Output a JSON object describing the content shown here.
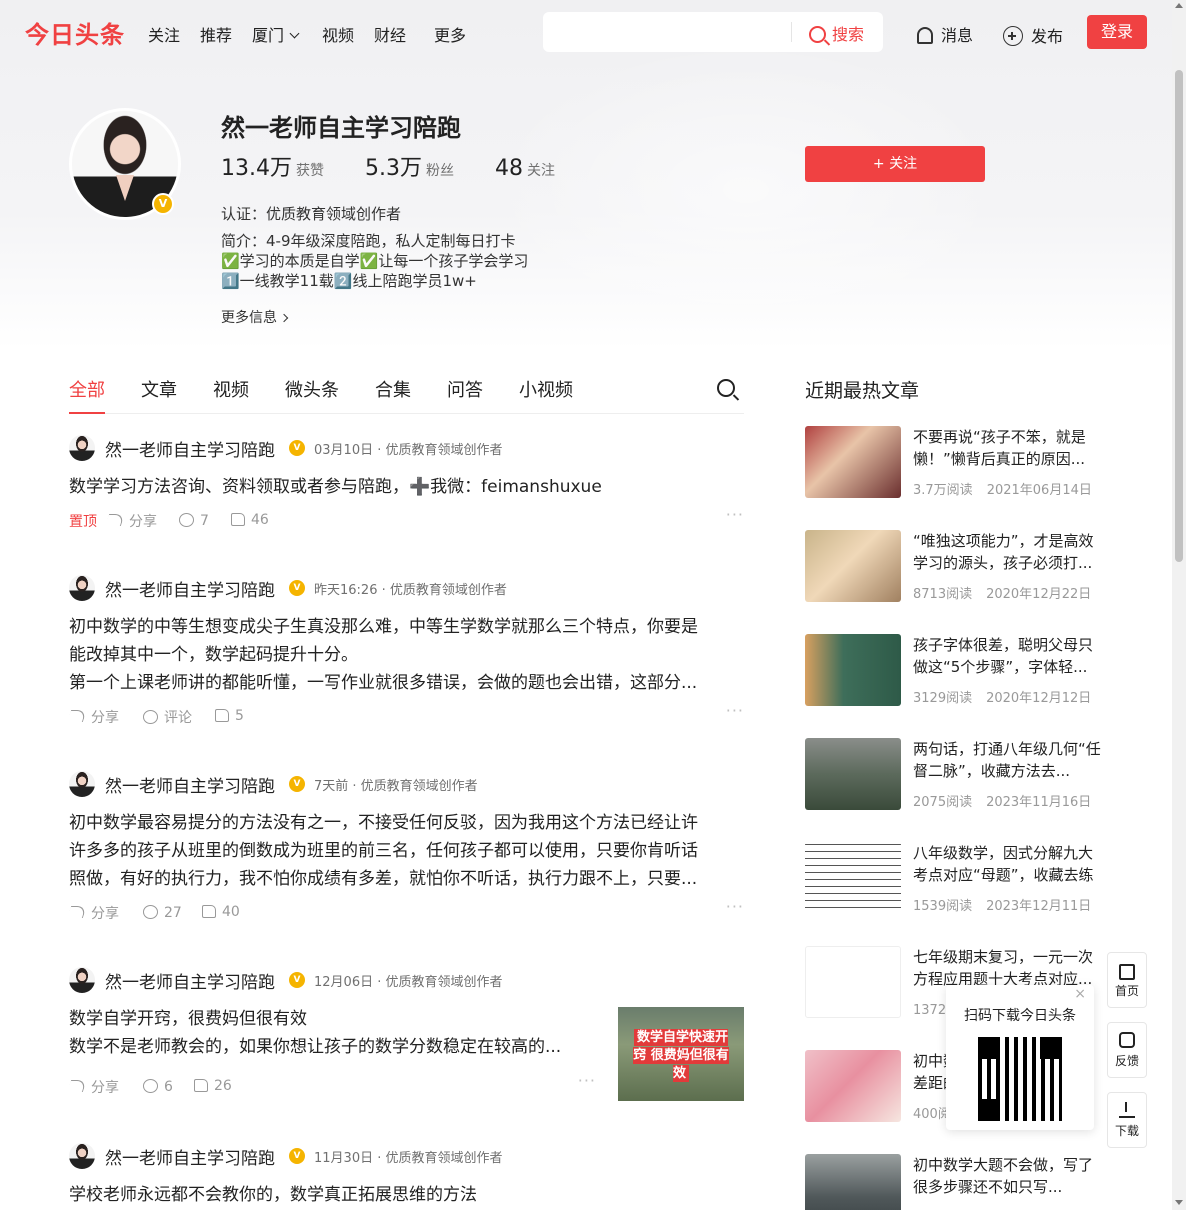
{
  "header": {
    "logo": "今日头条",
    "nav": [
      "关注",
      "推荐",
      "厦门",
      "视频",
      "财经",
      "更多"
    ],
    "search_button": "搜索",
    "search_placeholder": "",
    "messages": "消息",
    "publish": "发布",
    "login": "登录"
  },
  "profile": {
    "name": "然一老师自主学习陪跑",
    "stats": [
      {
        "value": "13.4万",
        "label": "获赞"
      },
      {
        "value": "5.3万",
        "label": "粉丝"
      },
      {
        "value": "48",
        "label": "关注"
      }
    ],
    "certification": "认证：优质教育领域创作者",
    "intro_lines": [
      "简介：4-9年级深度陪跑，私人定制每日打卡",
      "✅学习的本质是自学✅让每一个孩子学会学习",
      "1️⃣一线教学11载2️⃣线上陪跑学员1w+"
    ],
    "more_info": "更多信息",
    "follow_button": "+ 关注",
    "verified_mark": "V"
  },
  "tabs": [
    "全部",
    "文章",
    "视频",
    "微头条",
    "合集",
    "问答",
    "小视频"
  ],
  "posts": [
    {
      "author": "然一老师自主学习陪跑",
      "meta": "03月10日 · 优质教育领域创作者",
      "lines": [
        "数学学习方法咨询、资料领取或者参与陪跑，➕我微：feimanshuxue"
      ],
      "pinned": "置顶",
      "share": "分享",
      "comments": "7",
      "likes": "46"
    },
    {
      "author": "然一老师自主学习陪跑",
      "meta": "昨天16:26 · 优质教育领域创作者",
      "lines": [
        "初中数学的中等生想变成尖子生真没那么难，中等生学数学就那么三个特点，你要是",
        "能改掉其中一个，数学起码提升十分。",
        "第一个上课老师讲的都能听懂，一写作业就很多错误，会做的题也会出错，这部分..."
      ],
      "share": "分享",
      "comments": "评论",
      "likes": "5"
    },
    {
      "author": "然一老师自主学习陪跑",
      "meta": "7天前 · 优质教育领域创作者",
      "lines": [
        "初中数学最容易提分的方法没有之一，不接受任何反驳，因为我用这个方法已经让许",
        "许多多的孩子从班里的倒数成为班里的前三名，任何孩子都可以使用，只要你肯听话",
        "照做，有好的执行力，我不怕你成绩有多差，就怕你不听话，执行力跟不上，只要..."
      ],
      "share": "分享",
      "comments": "27",
      "likes": "40"
    },
    {
      "author": "然一老师自主学习陪跑",
      "meta": "12月06日 · 优质教育领域创作者",
      "lines": [
        "数学自学开窍，很费妈但很有效",
        "数学不是老师教会的，如果你想让孩子的数学分数稳定在较高的..."
      ],
      "thumb_caption": "数学自学快速开窍 很费妈但很有效",
      "share": "分享",
      "comments": "6",
      "likes": "26"
    },
    {
      "author": "然一老师自主学习陪跑",
      "meta": "11月30日 · 优质教育领域创作者",
      "lines": [
        "学校老师永远都不会教你的，数学真正拓展思维的方法"
      ]
    }
  ],
  "hot_articles": {
    "title": "近期最热文章",
    "items": [
      {
        "title": "不要再说“孩子不笨，就是懒！”懒背后真正的原因...",
        "reads": "3.7万阅读",
        "date": "2021年06月14日"
      },
      {
        "title": "“唯独这项能力”，才是高效学习的源头，孩子必须打...",
        "reads": "8713阅读",
        "date": "2020年12月22日"
      },
      {
        "title": "孩子字体很差，聪明父母只做这“5个步骤”，字体轻...",
        "reads": "3129阅读",
        "date": "2020年12月12日"
      },
      {
        "title": "两句话，打通八年级几何“任督二脉”，收藏方法去...",
        "reads": "2075阅读",
        "date": "2023年11月16日"
      },
      {
        "title": "八年级数学，因式分解九大考点对应“母题”，收藏去练",
        "reads": "1539阅读",
        "date": "2023年12月11日"
      },
      {
        "title": "七年级期末复习，一元一次方程应用题十大考点对应...",
        "reads": "1372阅读",
        "date": ""
      },
      {
        "title": "初中数学，在这个阶段拉开差距的孩子都是高段位",
        "reads": "400阅读",
        "date": ""
      },
      {
        "title": "初中数学大题不会做，写了很多步骤还不如只写...",
        "reads": "",
        "date": ""
      }
    ]
  },
  "side_bar": {
    "home": "首页",
    "feedback": "反馈",
    "download": "下载"
  },
  "qr_popup": {
    "text": "扫码下载今日头条",
    "close": "×"
  },
  "colors": {
    "accent": "#f04142",
    "verified": "#f5b400"
  }
}
